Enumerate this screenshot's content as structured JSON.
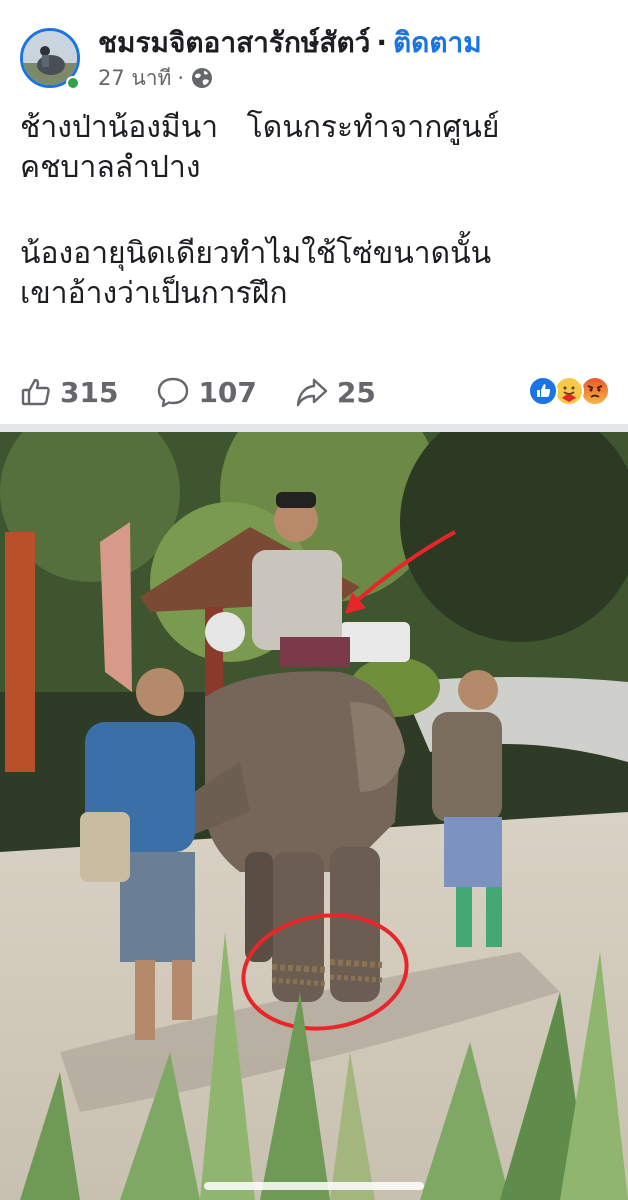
{
  "header": {
    "page_name": "ชมรมจิตอาสารักษ์สัตว์",
    "separator": "·",
    "follow_label": "ติดตาม",
    "time_ago": "27 นาที",
    "meta_separator": "·",
    "privacy_icon": "globe-icon"
  },
  "post": {
    "line1": "ช้างป่าน้องมีนา   โดนกระทำจากศูนย์",
    "line2": "คชบาลลำปาง",
    "line3": "น้องอายุนิดเดียวทำไมใช้โซ่ขนาดนั้น",
    "line4": "เขาอ้างว่าเป็นการฝึก"
  },
  "stats": {
    "likes": "315",
    "comments": "107",
    "shares": "25",
    "like_icon": "thumbs-up-icon",
    "comment_icon": "comment-icon",
    "share_icon": "share-icon",
    "reaction_icons": [
      "like-reaction-icon",
      "care-reaction-icon",
      "angry-reaction-icon"
    ]
  },
  "colors": {
    "brand_blue": "#1b74e4",
    "annotation_red": "#e8262a",
    "online_green": "#31a24c"
  }
}
